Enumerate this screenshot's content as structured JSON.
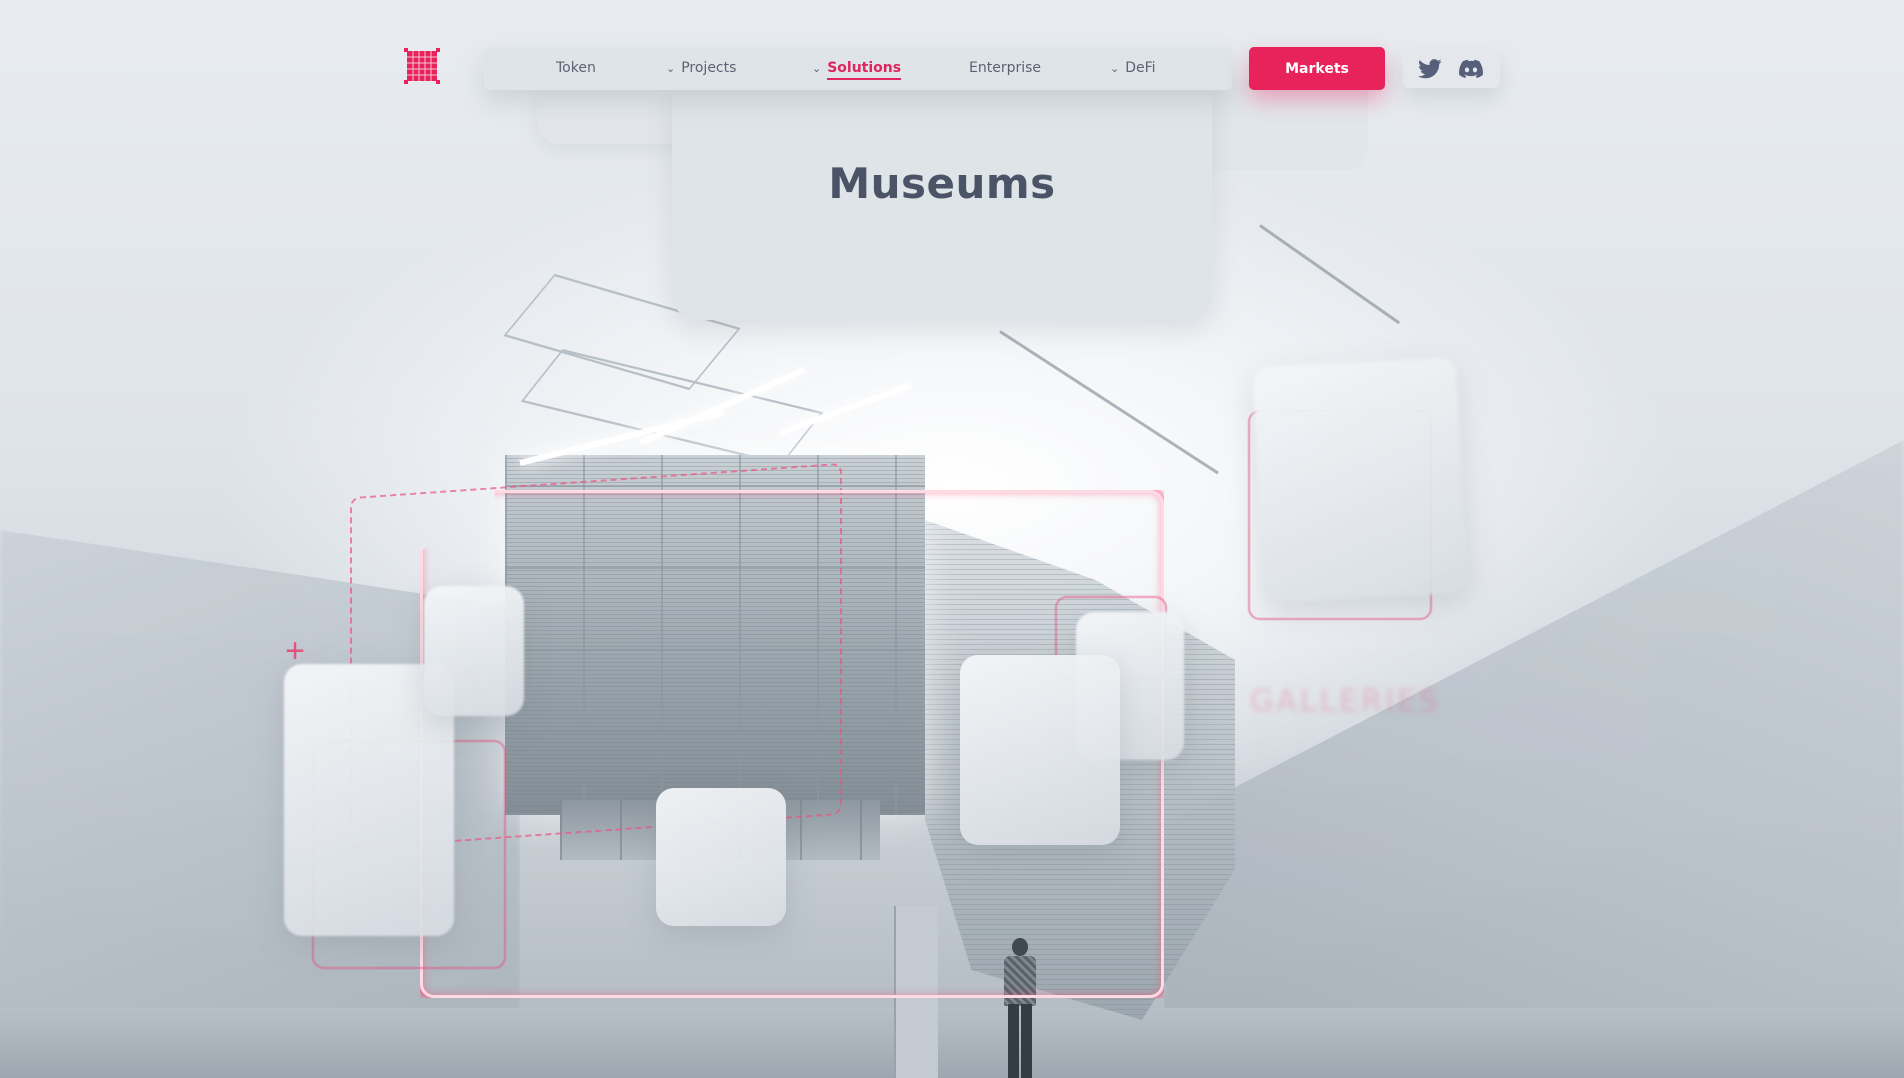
{
  "nav": {
    "items": [
      {
        "label": "Token",
        "has_dropdown": false,
        "active": false
      },
      {
        "label": "Projects",
        "has_dropdown": true,
        "active": false
      },
      {
        "label": "Solutions",
        "has_dropdown": true,
        "active": true
      },
      {
        "label": "Enterprise",
        "has_dropdown": false,
        "active": false
      },
      {
        "label": "DeFi",
        "has_dropdown": true,
        "active": false
      }
    ],
    "cta_label": "Markets",
    "social": [
      "twitter-icon",
      "discord-icon"
    ]
  },
  "hero": {
    "title": "Museums",
    "ghost_label": "GALLERIES"
  },
  "colors": {
    "accent": "#e8225a",
    "nav_bg": "#dfe4e9",
    "text": "#5b6373",
    "title_text": "#4b5466"
  },
  "icons": {
    "logo": "grid-logo-icon",
    "dropdown": "chevron-down-icon",
    "decoration": "plus-icon"
  }
}
